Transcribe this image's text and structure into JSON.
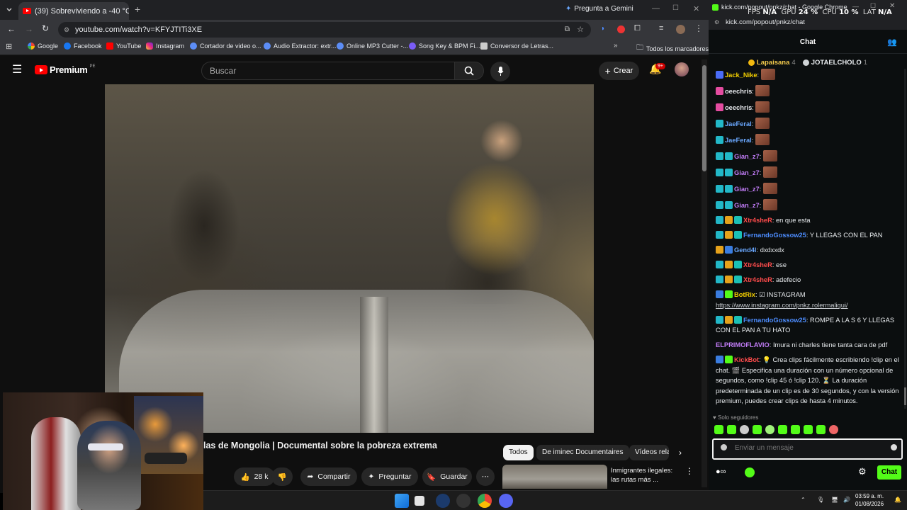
{
  "browser_left": {
    "tab_title": "(39) Sobreviviendo a -40 °C",
    "gemini_label": "Pregunta a Gemini",
    "url": "youtube.com/watch?v=KFYJTITi3XE",
    "bookmarks": [
      "Google",
      "Facebook",
      "YouTube",
      "Instagram",
      "Cortador de video o...",
      "Audio Extractor: extr...",
      "Online MP3 Cutter -...",
      "Song Key & BPM Fi...",
      "Conversor de Letras...",
      "Todos los marcadores"
    ]
  },
  "youtube": {
    "logo_text": "Premium",
    "logo_region": "PE",
    "search_placeholder": "Buscar",
    "create_label": "Crear",
    "notif_count": "9+",
    "video_title": "las de Mongolia | Documental sobre la pobreza extrema",
    "likes": "28 k",
    "share_label": "Compartir",
    "ask_label": "Preguntar",
    "save_label": "Guardar",
    "chips": [
      "Todos",
      "De iminec Documentaires",
      "Vídeos rela"
    ],
    "related_title_line1": "Inmigrantes ilegales:",
    "related_title_line2": "las rutas más ..."
  },
  "overlay": {
    "fps_label": "FPS",
    "fps_value": "N/A",
    "gpu_label": "GPU",
    "gpu_value": "24 %",
    "cpu_label": "CPU",
    "cpu_value": "10 %",
    "lat_label": "LAT",
    "lat_value": "N/A"
  },
  "kick": {
    "window_title": "kick.com/popout/pnkz/chat - Google Chrome",
    "url": "kick.com/popout/pnkz/chat",
    "chat_header": "Chat",
    "gifter1_name": "Lapaisana",
    "gifter1_count": "4",
    "gifter2_name": "JOTAELCHOLO",
    "gifter2_count": "1",
    "messages": [
      {
        "user": "Jack_Nike",
        "color": "#f5d000",
        "text": "",
        "emote": true,
        "badges": [
          "#4a6cf7"
        ]
      },
      {
        "user": "oeechris",
        "color": "#e5e7eb",
        "text": "",
        "emote": true,
        "badges": [
          "#e44ca0"
        ]
      },
      {
        "user": "oeechris",
        "color": "#e5e7eb",
        "text": "",
        "emote": true,
        "badges": [
          "#e44ca0"
        ]
      },
      {
        "user": "JaeFeral",
        "color": "#6aa8ff",
        "text": "",
        "emote": true,
        "badges": [
          "#22b8c8"
        ]
      },
      {
        "user": "JaeFeral",
        "color": "#6aa8ff",
        "text": "",
        "emote": true,
        "badges": [
          "#22b8c8"
        ]
      },
      {
        "user": "Gian_z7",
        "color": "#c17cf7",
        "text": "",
        "emote": true,
        "badges": [
          "#22b8c8",
          "#22b8c8"
        ]
      },
      {
        "user": "Gian_z7",
        "color": "#c17cf7",
        "text": "",
        "emote": true,
        "badges": [
          "#22b8c8",
          "#22b8c8"
        ]
      },
      {
        "user": "Gian_z7",
        "color": "#c17cf7",
        "text": "",
        "emote": true,
        "badges": [
          "#22b8c8",
          "#22b8c8"
        ]
      },
      {
        "user": "Gian_z7",
        "color": "#c17cf7",
        "text": "",
        "emote": true,
        "badges": [
          "#22b8c8",
          "#22b8c8"
        ]
      },
      {
        "user": "Xtr4sheR",
        "color": "#ff4c4c",
        "text": "en que esta",
        "emote": false,
        "badges": [
          "#22b8c8",
          "#e5a21b",
          "#1bc0b5"
        ]
      },
      {
        "user": "FernandoGossow25",
        "color": "#4d8dff",
        "text": "Y LLEGAS CON EL PAN",
        "emote": false,
        "badges": [
          "#22b8c8",
          "#e5a21b",
          "#1bc0b5"
        ]
      },
      {
        "user": "Gend4l",
        "color": "#6aa8ff",
        "text": "dxdxxdx",
        "emote": false,
        "badges": [
          "#e5a21b",
          "#3a7de0"
        ]
      },
      {
        "user": "Xtr4sheR",
        "color": "#ff4c4c",
        "text": "ese",
        "emote": false,
        "badges": [
          "#22b8c8",
          "#e5a21b",
          "#1bc0b5"
        ]
      },
      {
        "user": "Xtr4sheR",
        "color": "#ff4c4c",
        "text": "adefecio",
        "emote": false,
        "badges": [
          "#22b8c8",
          "#e5a21b",
          "#1bc0b5"
        ]
      },
      {
        "user": "BotRix",
        "color": "#f5d000",
        "text": "☑ INSTAGRAM",
        "link": "https://www.instagram.com/pnkz.rolermaliqui/",
        "emote": false,
        "badges": [
          "#3a7de0",
          "#53fc18"
        ]
      },
      {
        "user": "FernandoGossow25",
        "color": "#4d8dff",
        "text": "ROMPE A LA S 6 Y LLEGAS CON EL PAN A TU HATO",
        "emote": false,
        "badges": [
          "#22b8c8",
          "#e5a21b",
          "#1bc0b5"
        ]
      },
      {
        "user": "ELPRIMOFLAVIO",
        "color": "#c17cf7",
        "text": "Imura ni charles tiene tanta cara de pdf",
        "emote": false,
        "badges": []
      },
      {
        "user": "KickBot",
        "color": "#ff4c4c",
        "text": "💡 Crea clips fácilmente escribiendo !clip en el chat. 🎬 Especifica una duración con un número opcional de segundos, como !clip 45 ó !clip 120. ⏳ La duración predeterminada de un clip es de 30 segundos, y con la versión premium, puedes crear clips de hasta 4 minutos.",
        "emote": false,
        "badges": [
          "#3a7de0",
          "#53fc18"
        ]
      }
    ],
    "followers_only": "Solo seguidores",
    "input_placeholder": "Enviar un mensaje",
    "send_label": "Chat"
  },
  "taskbar": {
    "clock_time": "03:59 a. m.",
    "clock_date": "01/08/2026"
  }
}
